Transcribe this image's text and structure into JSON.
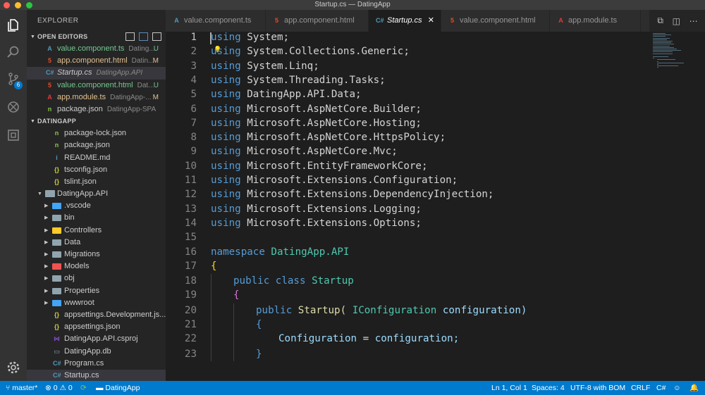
{
  "window": {
    "title": "Startup.cs — DatingApp"
  },
  "activity_bar": {
    "scm_badge": "6"
  },
  "sidebar": {
    "title": "EXPLORER",
    "open_editors": {
      "label": "OPEN EDITORS",
      "items": [
        {
          "name": "value.component.ts",
          "desc": "Dating...",
          "status": "U",
          "color": "#73c991",
          "icon": "A",
          "icon_color": "#519aba"
        },
        {
          "name": "app.component.html",
          "desc": "Datin...",
          "status": "M",
          "color": "#e2c08d",
          "icon": "5",
          "icon_color": "#e44d26"
        },
        {
          "name": "Startup.cs",
          "desc": "DatingApp.API",
          "status": "",
          "color": "#cccccc",
          "icon": "C#",
          "icon_color": "#519aba"
        },
        {
          "name": "value.component.html",
          "desc": "Dat...",
          "status": "U",
          "color": "#73c991",
          "icon": "5",
          "icon_color": "#e44d26"
        },
        {
          "name": "app.module.ts",
          "desc": "DatingApp-...",
          "status": "M",
          "color": "#e2c08d",
          "icon": "A",
          "icon_color": "#e03b3b"
        },
        {
          "name": "package.json",
          "desc": "DatingApp-SPA",
          "status": "",
          "color": "#cccccc",
          "icon": "n",
          "icon_color": "#8bc34a"
        }
      ]
    },
    "project": {
      "label": "DATINGAPP",
      "items": [
        {
          "name": "package-lock.json",
          "icon": "n",
          "icon_color": "#8bc34a"
        },
        {
          "name": "package.json",
          "icon": "n",
          "icon_color": "#8bc34a"
        },
        {
          "name": "README.md",
          "icon": "i",
          "icon_color": "#519aba"
        },
        {
          "name": "tsconfig.json",
          "icon": "{}",
          "icon_color": "#cbcb41"
        },
        {
          "name": "tslint.json",
          "icon": "{}",
          "icon_color": "#cbcb41"
        }
      ],
      "api_folder": "DatingApp.API",
      "api_items": [
        {
          "name": ".vscode",
          "folder": true,
          "icon_color": "#42a5f5"
        },
        {
          "name": "bin",
          "folder": true,
          "icon_color": "#90a4ae"
        },
        {
          "name": "Controllers",
          "folder": true,
          "icon_color": "#ffca28"
        },
        {
          "name": "Data",
          "folder": true,
          "icon_color": "#90a4ae"
        },
        {
          "name": "Migrations",
          "folder": true,
          "icon_color": "#90a4ae"
        },
        {
          "name": "Models",
          "folder": true,
          "icon_color": "#ef5350"
        },
        {
          "name": "obj",
          "folder": true,
          "icon_color": "#90a4ae"
        },
        {
          "name": "Properties",
          "folder": true,
          "icon_color": "#90a4ae"
        },
        {
          "name": "wwwroot",
          "folder": true,
          "icon_color": "#42a5f5"
        },
        {
          "name": "appsettings.Development.js...",
          "folder": false,
          "icon": "{}",
          "icon_color": "#cbcb41"
        },
        {
          "name": "appsettings.json",
          "folder": false,
          "icon": "{}",
          "icon_color": "#cbcb41"
        },
        {
          "name": "DatingApp.API.csproj",
          "folder": false,
          "icon": "⋈",
          "icon_color": "#854cc7"
        },
        {
          "name": "DatingApp.db",
          "folder": false,
          "icon": "▭",
          "icon_color": "#90a4ae"
        },
        {
          "name": "Program.cs",
          "folder": false,
          "icon": "C#",
          "icon_color": "#519aba"
        },
        {
          "name": "Startup.cs",
          "folder": false,
          "icon": "C#",
          "icon_color": "#519aba"
        }
      ]
    }
  },
  "tabs": [
    {
      "label": "value.component.ts",
      "icon": "A",
      "icon_color": "#519aba",
      "active": false
    },
    {
      "label": "app.component.html",
      "icon": "5",
      "icon_color": "#e44d26",
      "active": false
    },
    {
      "label": "Startup.cs",
      "icon": "C#",
      "icon_color": "#519aba",
      "active": true
    },
    {
      "label": "value.component.html",
      "icon": "5",
      "icon_color": "#e44d26",
      "active": false
    },
    {
      "label": "app.module.ts",
      "icon": "A",
      "icon_color": "#e03b3b",
      "active": false
    }
  ],
  "code_lines": [
    {
      "n": "1",
      "indent": 0,
      "tokens": [
        [
          "kw",
          "using"
        ],
        [
          "",
          "System;"
        ]
      ]
    },
    {
      "n": "2",
      "indent": 0,
      "tokens": [
        [
          "kw",
          "using"
        ],
        [
          "",
          "System.Collections.Generic;"
        ]
      ]
    },
    {
      "n": "3",
      "indent": 0,
      "tokens": [
        [
          "kw",
          "using"
        ],
        [
          "",
          "System.Linq;"
        ]
      ]
    },
    {
      "n": "4",
      "indent": 0,
      "tokens": [
        [
          "kw",
          "using"
        ],
        [
          "",
          "System.Threading.Tasks;"
        ]
      ]
    },
    {
      "n": "5",
      "indent": 0,
      "tokens": [
        [
          "kw",
          "using"
        ],
        [
          "",
          "DatingApp.API.Data;"
        ]
      ]
    },
    {
      "n": "6",
      "indent": 0,
      "tokens": [
        [
          "kw",
          "using"
        ],
        [
          "",
          "Microsoft.AspNetCore.Builder;"
        ]
      ]
    },
    {
      "n": "7",
      "indent": 0,
      "tokens": [
        [
          "kw",
          "using"
        ],
        [
          "",
          "Microsoft.AspNetCore.Hosting;"
        ]
      ]
    },
    {
      "n": "8",
      "indent": 0,
      "tokens": [
        [
          "kw",
          "using"
        ],
        [
          "",
          "Microsoft.AspNetCore.HttpsPolicy;"
        ]
      ]
    },
    {
      "n": "9",
      "indent": 0,
      "tokens": [
        [
          "kw",
          "using"
        ],
        [
          "",
          "Microsoft.AspNetCore.Mvc;"
        ]
      ]
    },
    {
      "n": "10",
      "indent": 0,
      "tokens": [
        [
          "kw",
          "using"
        ],
        [
          "",
          "Microsoft.EntityFrameworkCore;"
        ]
      ]
    },
    {
      "n": "11",
      "indent": 0,
      "tokens": [
        [
          "kw",
          "using"
        ],
        [
          "",
          "Microsoft.Extensions.Configuration;"
        ]
      ]
    },
    {
      "n": "12",
      "indent": 0,
      "tokens": [
        [
          "kw",
          "using"
        ],
        [
          "",
          "Microsoft.Extensions.DependencyInjection;"
        ]
      ]
    },
    {
      "n": "13",
      "indent": 0,
      "tokens": [
        [
          "kw",
          "using"
        ],
        [
          "",
          "Microsoft.Extensions.Logging;"
        ]
      ]
    },
    {
      "n": "14",
      "indent": 0,
      "tokens": [
        [
          "kw",
          "using"
        ],
        [
          "",
          "Microsoft.Extensions.Options;"
        ]
      ]
    },
    {
      "n": "15",
      "indent": 0,
      "tokens": []
    },
    {
      "n": "16",
      "indent": 0,
      "tokens": [
        [
          "kw",
          "namespace"
        ],
        [
          "ns",
          "DatingApp.API"
        ]
      ]
    },
    {
      "n": "17",
      "indent": 0,
      "tokens": [
        [
          "br1",
          "{"
        ]
      ]
    },
    {
      "n": "18",
      "indent": 1,
      "tokens": [
        [
          "kw",
          "public"
        ],
        [
          "kw",
          "class"
        ],
        [
          "ty",
          "Startup"
        ]
      ]
    },
    {
      "n": "19",
      "indent": 1,
      "tokens": [
        [
          "br2",
          "{"
        ]
      ]
    },
    {
      "n": "20",
      "indent": 2,
      "tokens": [
        [
          "kw",
          "public"
        ],
        [
          "fn",
          "Startup("
        ],
        [
          "ty",
          "IConfiguration"
        ],
        [
          "vr",
          "configuration)"
        ]
      ]
    },
    {
      "n": "21",
      "indent": 2,
      "tokens": [
        [
          "kw",
          "{"
        ]
      ]
    },
    {
      "n": "22",
      "indent": 3,
      "tokens": [
        [
          "vr",
          "Configuration"
        ],
        [
          "",
          "="
        ],
        [
          "vr",
          "configuration;"
        ]
      ]
    },
    {
      "n": "23",
      "indent": 2,
      "tokens": [
        [
          "kw",
          "}"
        ]
      ]
    }
  ],
  "status_bar": {
    "branch": "master*",
    "errors": "0",
    "warnings": "0",
    "folder": "DatingApp",
    "position": "Ln 1, Col 1",
    "spaces": "Spaces: 4",
    "encoding": "UTF-8 with BOM",
    "eol": "CRLF",
    "language": "C#"
  }
}
